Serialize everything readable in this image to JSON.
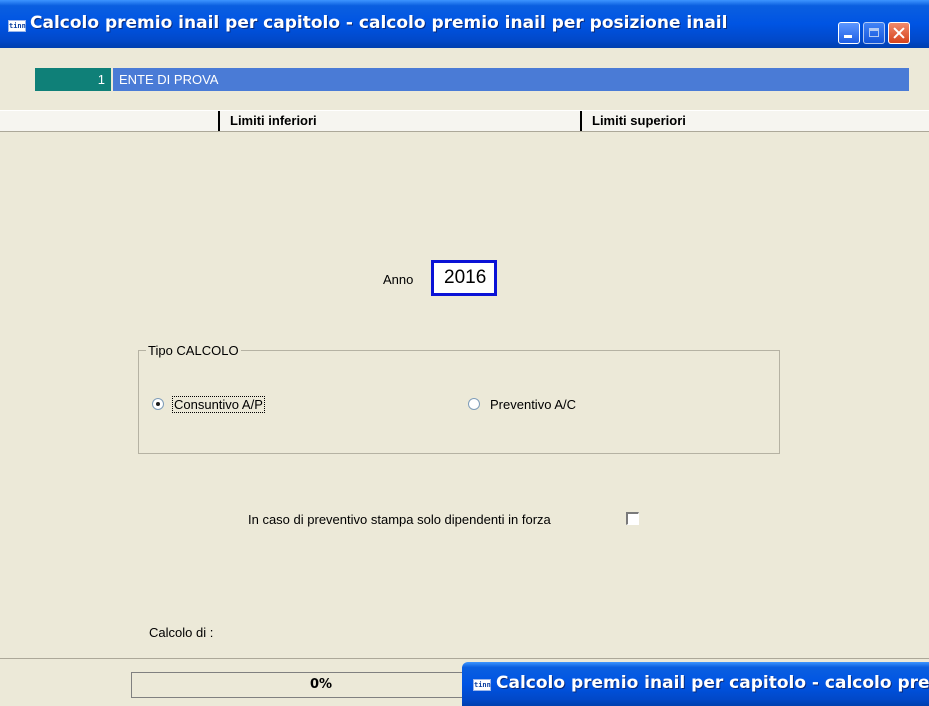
{
  "window": {
    "title": "Calcolo premio inail per capitolo - calcolo premio inail per posizione inail",
    "icon_text": "tinn",
    "colors": {
      "titlebar": "#0054e3",
      "accent_input_border": "#0a12d6",
      "ente_code_bg": "#0f8078",
      "ente_name_bg": "#4a7bd6"
    }
  },
  "ente": {
    "code": "1",
    "name": "ENTE DI PROVA"
  },
  "header": {
    "limiti_inferiori": "Limiti inferiori",
    "limiti_superiori": "Limiti superiori"
  },
  "anno": {
    "label": "Anno",
    "value": "2016"
  },
  "tipo_calcolo": {
    "legend": "Tipo CALCOLO",
    "options": [
      {
        "label": "Consuntivo A/P",
        "selected": true
      },
      {
        "label": "Preventivo A/C",
        "selected": false
      }
    ]
  },
  "preventivo_option": {
    "label": "In caso di preventivo stampa solo dipendenti in forza",
    "checked": false
  },
  "calcolo_di": {
    "label": "Calcolo di :"
  },
  "progress": {
    "value": 0,
    "text": "0%"
  },
  "child_window": {
    "title": "Calcolo premio inail per capitolo - calcolo premio inail per posizione inail",
    "icon_text": "tinn"
  }
}
